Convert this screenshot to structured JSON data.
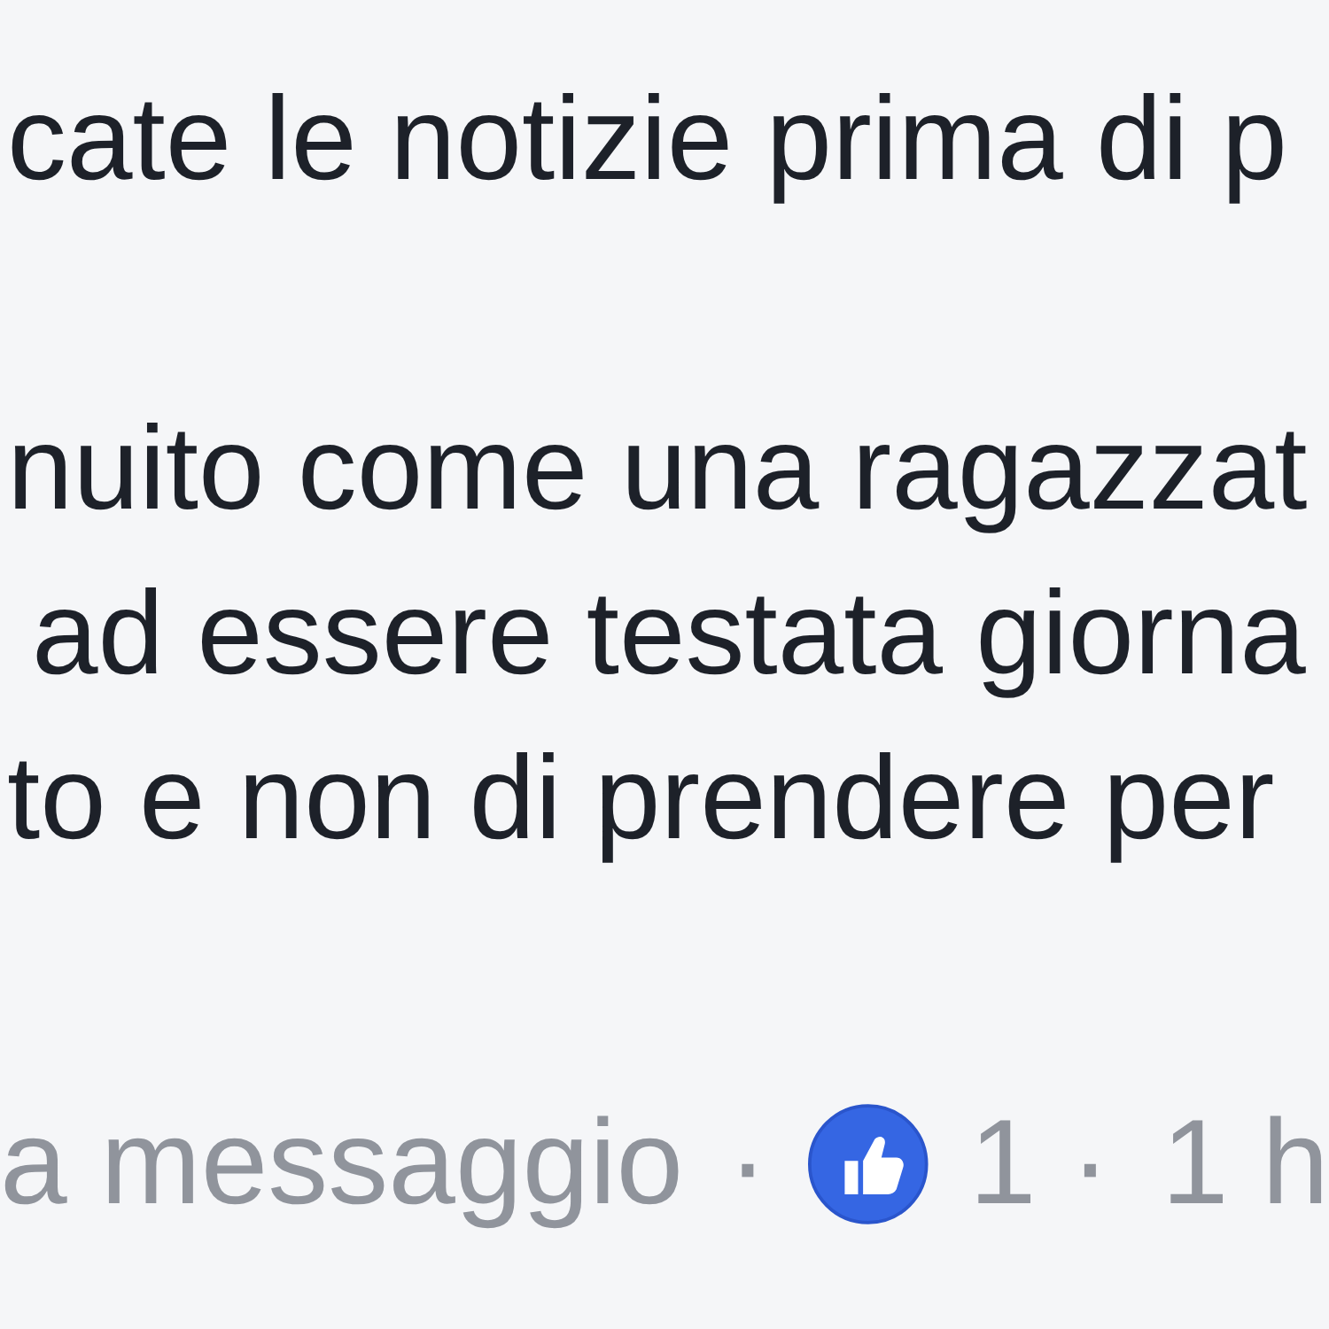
{
  "comment": {
    "paragraphs": [
      {
        "lines": [
          "cate le notizie prima di p"
        ]
      },
      {
        "lines": [
          "nuito come una ragazzat",
          "ad essere testata giorna",
          "to e non di prendere per"
        ]
      }
    ],
    "footer": [
      {
        "kind": "link",
        "text": "a messaggio"
      },
      {
        "kind": "separator",
        "text": "·"
      },
      {
        "kind": "reactions",
        "text": "1"
      },
      {
        "kind": "separator",
        "text": "·"
      },
      {
        "kind": "time",
        "text": "1 h"
      }
    ]
  }
}
